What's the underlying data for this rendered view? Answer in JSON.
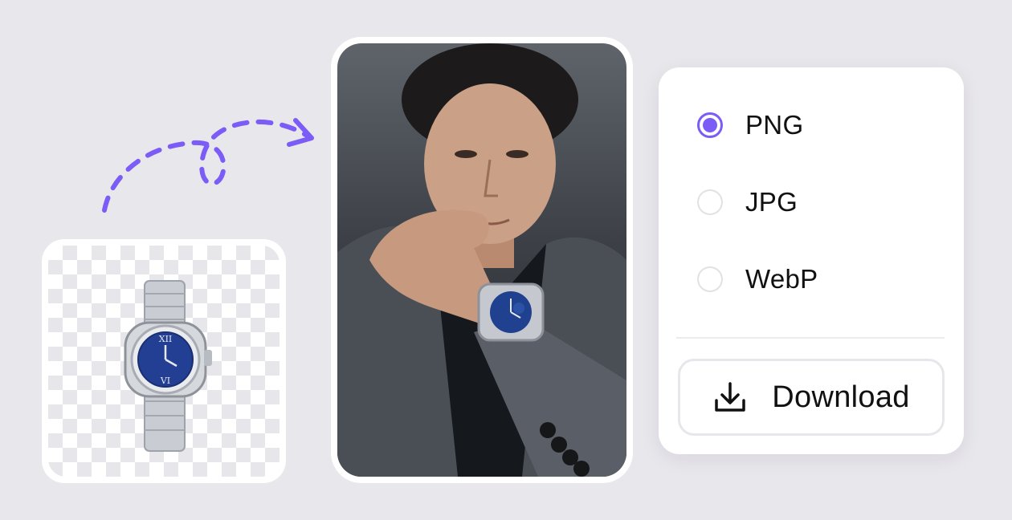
{
  "accent_color": "#7c5cf6",
  "format_options": {
    "items": [
      {
        "label": "PNG",
        "selected": true
      },
      {
        "label": "JPG",
        "selected": false
      },
      {
        "label": "WebP",
        "selected": false
      }
    ]
  },
  "download": {
    "label": "Download",
    "icon": "download-icon"
  },
  "illustrations": {
    "product": "watch-cutout-image",
    "photo": "model-wearing-watch-image",
    "arrow": "dashed-curved-arrow"
  }
}
